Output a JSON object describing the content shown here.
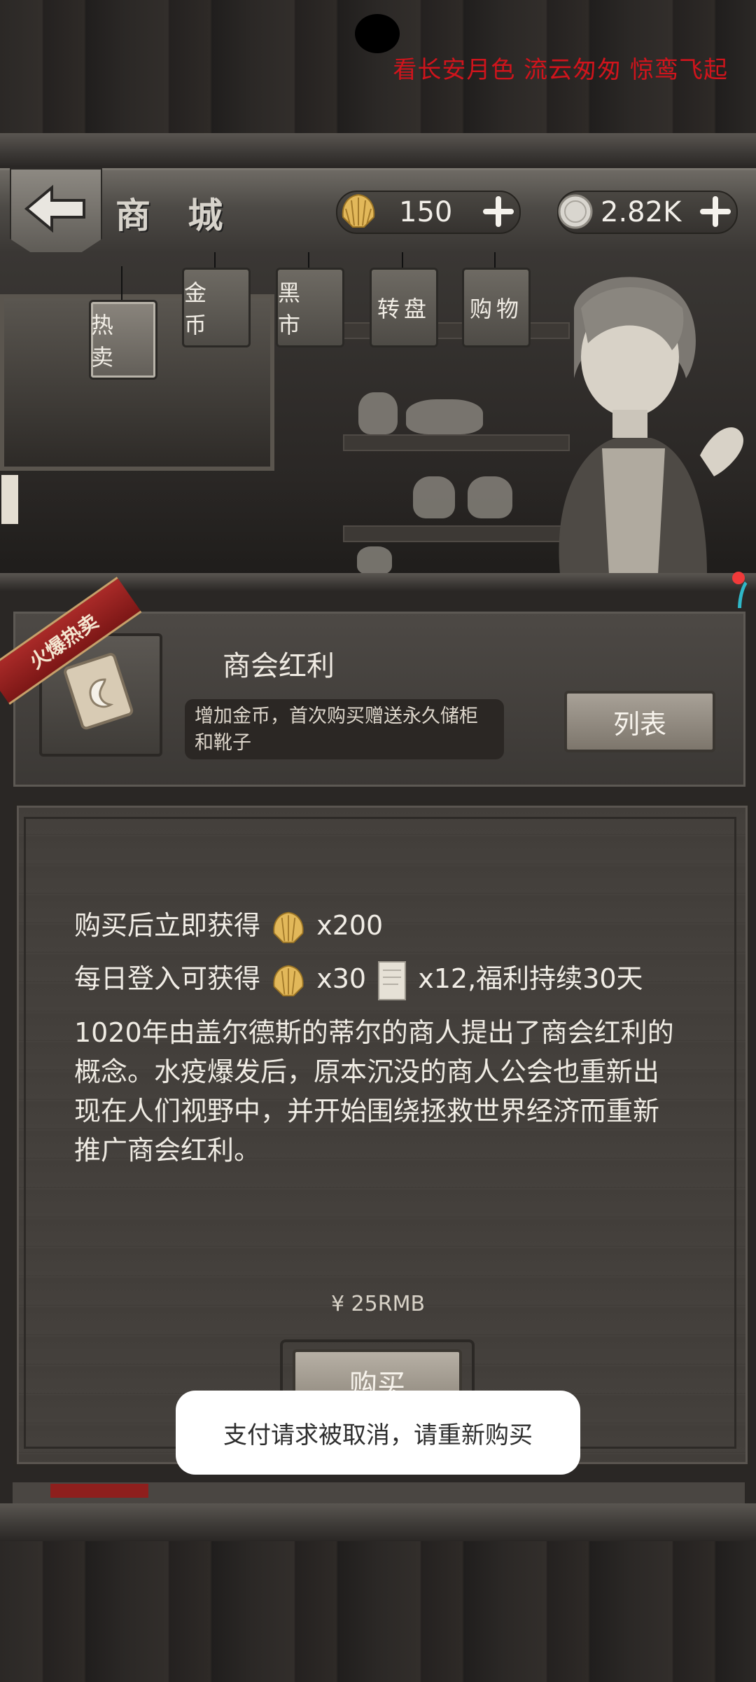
{
  "overlay": {
    "marquee": "看长安月色 流云匆匆 惊鸾飞起"
  },
  "header": {
    "title": "商 城",
    "shells": {
      "value": "150",
      "icon": "shell-icon"
    },
    "silver": {
      "value": "2.82K",
      "icon": "silver-coin-icon"
    }
  },
  "tabs": [
    {
      "label": "热 卖",
      "active": true
    },
    {
      "label": "金 币",
      "active": false
    },
    {
      "label": "黑 市",
      "active": false
    },
    {
      "label": "转盘",
      "active": false
    },
    {
      "label": "购物",
      "active": false
    }
  ],
  "item": {
    "badge": "火爆热卖",
    "name": "商会红利",
    "description": "增加金币，首次购买赠送永久储柜和靴子",
    "list_button": "列表"
  },
  "detail": {
    "line1_prefix": "购买后立即获得",
    "line1_qty": "x200",
    "line2_prefix": "每日登入可获得",
    "line2_qty1": "x30",
    "line2_qty2": "x12",
    "line2_suffix": ",福利持续30天",
    "paragraph": "1020年由盖尔德斯的蒂尔的商人提出了商会红利的概念。水疫爆发后，原本沉没的商人公会也重新出现在人们视野中，并开始围绕拯救世界经济而重新推广商会红利。",
    "price": "¥ 25RMB",
    "buy_button": "购买"
  },
  "toast": {
    "message": "支付请求被取消，请重新购买"
  },
  "colors": {
    "accent_red": "#d0141c",
    "ribbon": "#8e1f1d",
    "toast_bg": "#ffffff"
  }
}
